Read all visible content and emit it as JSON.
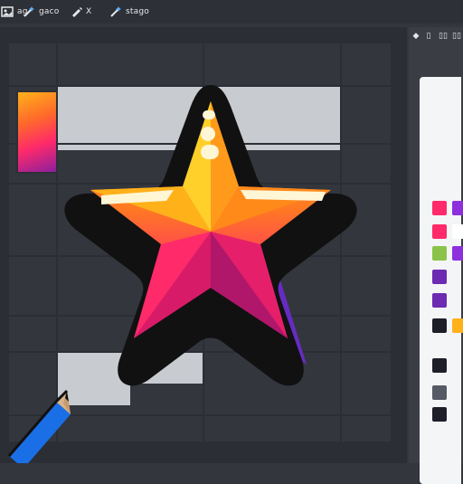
{
  "toolbar": {
    "items": [
      {
        "icon": "image-icon",
        "label": "ag"
      },
      {
        "icon": "magic-wand-icon",
        "label": "gaco"
      },
      {
        "icon": "pen-tool-icon",
        "label": "X"
      },
      {
        "icon": "magic-wand-icon",
        "label": "stago"
      }
    ]
  },
  "right_panel": {
    "tabs": [
      "◆",
      "▯",
      "▯▯",
      "▯▯"
    ],
    "swatches": [
      "#ff2a6a",
      "#8d2fdc",
      "#ff2a6a",
      "#ffffff",
      "#8bc34a",
      "#8d2fdc",
      "#6c2bb2",
      "#1e1e2a",
      "#ffb11a",
      "#1e1e2a",
      "#1e1e2a",
      "#555a66",
      "#1e1e2a"
    ]
  },
  "colors": {
    "star_outline": "#111111",
    "star_top": "#ffb11a",
    "star_mid": "#ff6a2a",
    "star_bottom": "#ff2a6a",
    "star_shadow": "#6b2bcf"
  }
}
